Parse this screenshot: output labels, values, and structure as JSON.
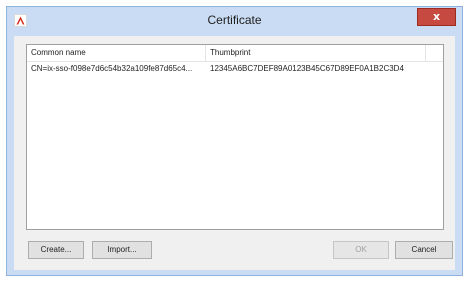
{
  "window": {
    "title": "Certificate",
    "close_label": "x"
  },
  "list": {
    "columns": [
      "Common name",
      "Thumbprint",
      ""
    ],
    "rows": [
      {
        "common_name": "CN=ix-sso-f098e7d6c54b32a109fe87d65c4...",
        "thumbprint": "12345A6BC7DEF89A0123B45C67D89EF0A1B2C3D4"
      }
    ]
  },
  "buttons": {
    "create": "Create...",
    "import": "Import...",
    "ok": "OK",
    "cancel": "Cancel"
  },
  "colors": {
    "frame": "#c9dcf3",
    "close_button": "#c64a3f",
    "app_icon": "#d52b1e"
  }
}
